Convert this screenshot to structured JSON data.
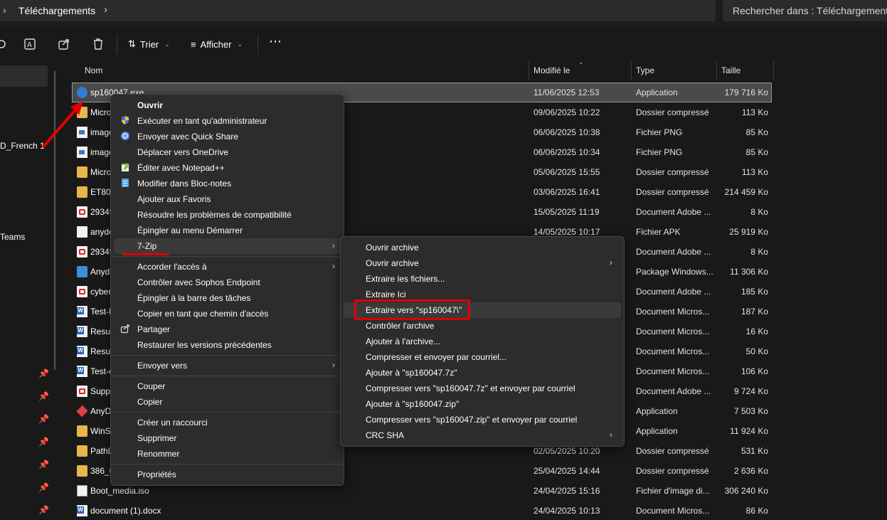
{
  "address": {
    "breadcrumb": "Téléchargements"
  },
  "search": {
    "placeholder": "Rechercher dans : Téléchargements"
  },
  "toolbar": {
    "sort_label": "Trier",
    "view_label": "Afficher"
  },
  "nav": {
    "items": [
      {
        "label": "D_French 1"
      },
      {
        "label": "Teams"
      }
    ]
  },
  "columns": {
    "name": "Nom",
    "modified": "Modifié le",
    "type": "Type",
    "size": "Taille"
  },
  "files": [
    {
      "name": "sp160047.exe",
      "date": "11/06/2025 12:53",
      "type": "Application",
      "size": "179 716 Ko",
      "icon": "exe-icon",
      "selected": true
    },
    {
      "name": "Micro",
      "date": "09/06/2025 10:22",
      "type": "Dossier compressé",
      "size": "113 Ko",
      "icon": "zip-folder-icon"
    },
    {
      "name": "image",
      "date": "06/06/2025 10:38",
      "type": "Fichier PNG",
      "size": "85 Ko",
      "icon": "png-icon"
    },
    {
      "name": "image",
      "date": "06/06/2025 10:34",
      "type": "Fichier PNG",
      "size": "85 Ko",
      "icon": "png-icon"
    },
    {
      "name": "Micro",
      "date": "05/06/2025 15:55",
      "type": "Dossier compressé",
      "size": "113 Ko",
      "icon": "zip-folder-icon"
    },
    {
      "name": "ET80-",
      "date": "03/06/2025 16:41",
      "type": "Dossier compressé",
      "size": "214 459 Ko",
      "icon": "zip-folder-icon"
    },
    {
      "name": "29349",
      "date": "15/05/2025 11:19",
      "type": "Document Adobe ...",
      "size": "8 Ko",
      "icon": "pdf-icon"
    },
    {
      "name": "anyde",
      "date": "14/05/2025 10:17",
      "type": "Fichier APK",
      "size": "25 919 Ko",
      "icon": "file-icon"
    },
    {
      "name": "29349",
      "date": "",
      "type": "Document Adobe ...",
      "size": "8 Ko",
      "icon": "pdf-icon"
    },
    {
      "name": "Anyd",
      "date": "",
      "type": "Package Windows...",
      "size": "11 306 Ko",
      "icon": "package-icon"
    },
    {
      "name": "cyber",
      "date": "",
      "type": "Document Adobe ...",
      "size": "185 Ko",
      "icon": "pdf-icon"
    },
    {
      "name": "Test-D",
      "date": "",
      "type": "Document Micros...",
      "size": "187 Ko",
      "icon": "word-icon"
    },
    {
      "name": "Resul",
      "date": "",
      "type": "Document Micros...",
      "size": "16 Ko",
      "icon": "word-icon"
    },
    {
      "name": "Resul",
      "date": "",
      "type": "Document Micros...",
      "size": "50 Ko",
      "icon": "word-icon"
    },
    {
      "name": "Test-e",
      "date": "",
      "type": "Document Micros...",
      "size": "106 Ko",
      "icon": "word-icon"
    },
    {
      "name": "Suppo",
      "date": "",
      "type": "Document Adobe ...",
      "size": "9 724 Ko",
      "icon": "pdf-icon"
    },
    {
      "name": "AnyD",
      "date": "",
      "type": "Application",
      "size": "7 503 Ko",
      "icon": "anydesk-icon"
    },
    {
      "name": "WinS",
      "date": "",
      "type": "Application",
      "size": "11 924 Ko",
      "icon": "installer-icon"
    },
    {
      "name": "PathL",
      "date": "02/05/2025 10:20",
      "type": "Dossier compressé",
      "size": "531 Ko",
      "icon": "zip-folder-icon"
    },
    {
      "name": "386_0",
      "date": "25/04/2025 14:44",
      "type": "Dossier compressé",
      "size": "2 636 Ko",
      "icon": "zip-folder-icon"
    },
    {
      "name": "Boot_media.iso",
      "date": "24/04/2025 15:16",
      "type": "Fichier d'image di...",
      "size": "306 240 Ko",
      "icon": "iso-icon"
    },
    {
      "name": "document (1).docx",
      "date": "24/04/2025 10:13",
      "type": "Document Micros...",
      "size": "86 Ko",
      "icon": "word-icon"
    }
  ],
  "context_menu": {
    "items": [
      {
        "label": "Ouvrir",
        "bold": true
      },
      {
        "label": "Exécuter en tant qu'administrateur",
        "icon": "shield-icon"
      },
      {
        "label": "Envoyer avec Quick Share",
        "icon": "quick-share-icon"
      },
      {
        "label": "Déplacer vers OneDrive"
      },
      {
        "label": "Éditer avec Notepad++",
        "icon": "notepadpp-icon"
      },
      {
        "label": "Modifier dans Bloc-notes",
        "icon": "notepad-icon"
      },
      {
        "label": "Ajouter aux Favoris"
      },
      {
        "label": "Résoudre les problèmes de compatibilité"
      },
      {
        "label": "Épingler au menu Démarrer"
      },
      {
        "label": "7-Zip",
        "submenu": true,
        "highlighted": true
      },
      {
        "label": "Accorder l'accès à",
        "submenu": true
      },
      {
        "label": "Contrôler avec Sophos Endpoint"
      },
      {
        "label": "Épingler à la barre des tâches"
      },
      {
        "label": "Copier en tant que chemin d'accès"
      },
      {
        "label": "Partager",
        "icon": "share-icon"
      },
      {
        "label": "Restaurer les versions précédentes"
      },
      {
        "label": "Envoyer vers",
        "submenu": true
      },
      {
        "label": "Couper"
      },
      {
        "label": "Copier"
      },
      {
        "label": "Créer un raccourci"
      },
      {
        "label": "Supprimer"
      },
      {
        "label": "Renommer"
      },
      {
        "label": "Propriétés"
      }
    ]
  },
  "zip_submenu": {
    "items": [
      {
        "label": "Ouvrir archive"
      },
      {
        "label": "Ouvrir archive",
        "submenu": true
      },
      {
        "label": "Extraire les fichiers..."
      },
      {
        "label": "Extraire Ici"
      },
      {
        "label": "Extraire vers \"sp160047\\\"",
        "highlighted": true
      },
      {
        "label": "Contrôler l'archive"
      },
      {
        "label": "Ajouter à l'archive..."
      },
      {
        "label": "Compresser et envoyer par courriel..."
      },
      {
        "label": "Ajouter à \"sp160047.7z\""
      },
      {
        "label": "Compresser vers \"sp160047.7z\" et envoyer par courriel"
      },
      {
        "label": "Ajouter à \"sp160047.zip\""
      },
      {
        "label": "Compresser vers \"sp160047.zip\" et envoyer par courriel"
      },
      {
        "label": "CRC SHA",
        "submenu": true
      }
    ]
  },
  "colors": {
    "annotation_red": "#e00000",
    "background": "#191919",
    "menu_bg": "#2c2c2c"
  }
}
